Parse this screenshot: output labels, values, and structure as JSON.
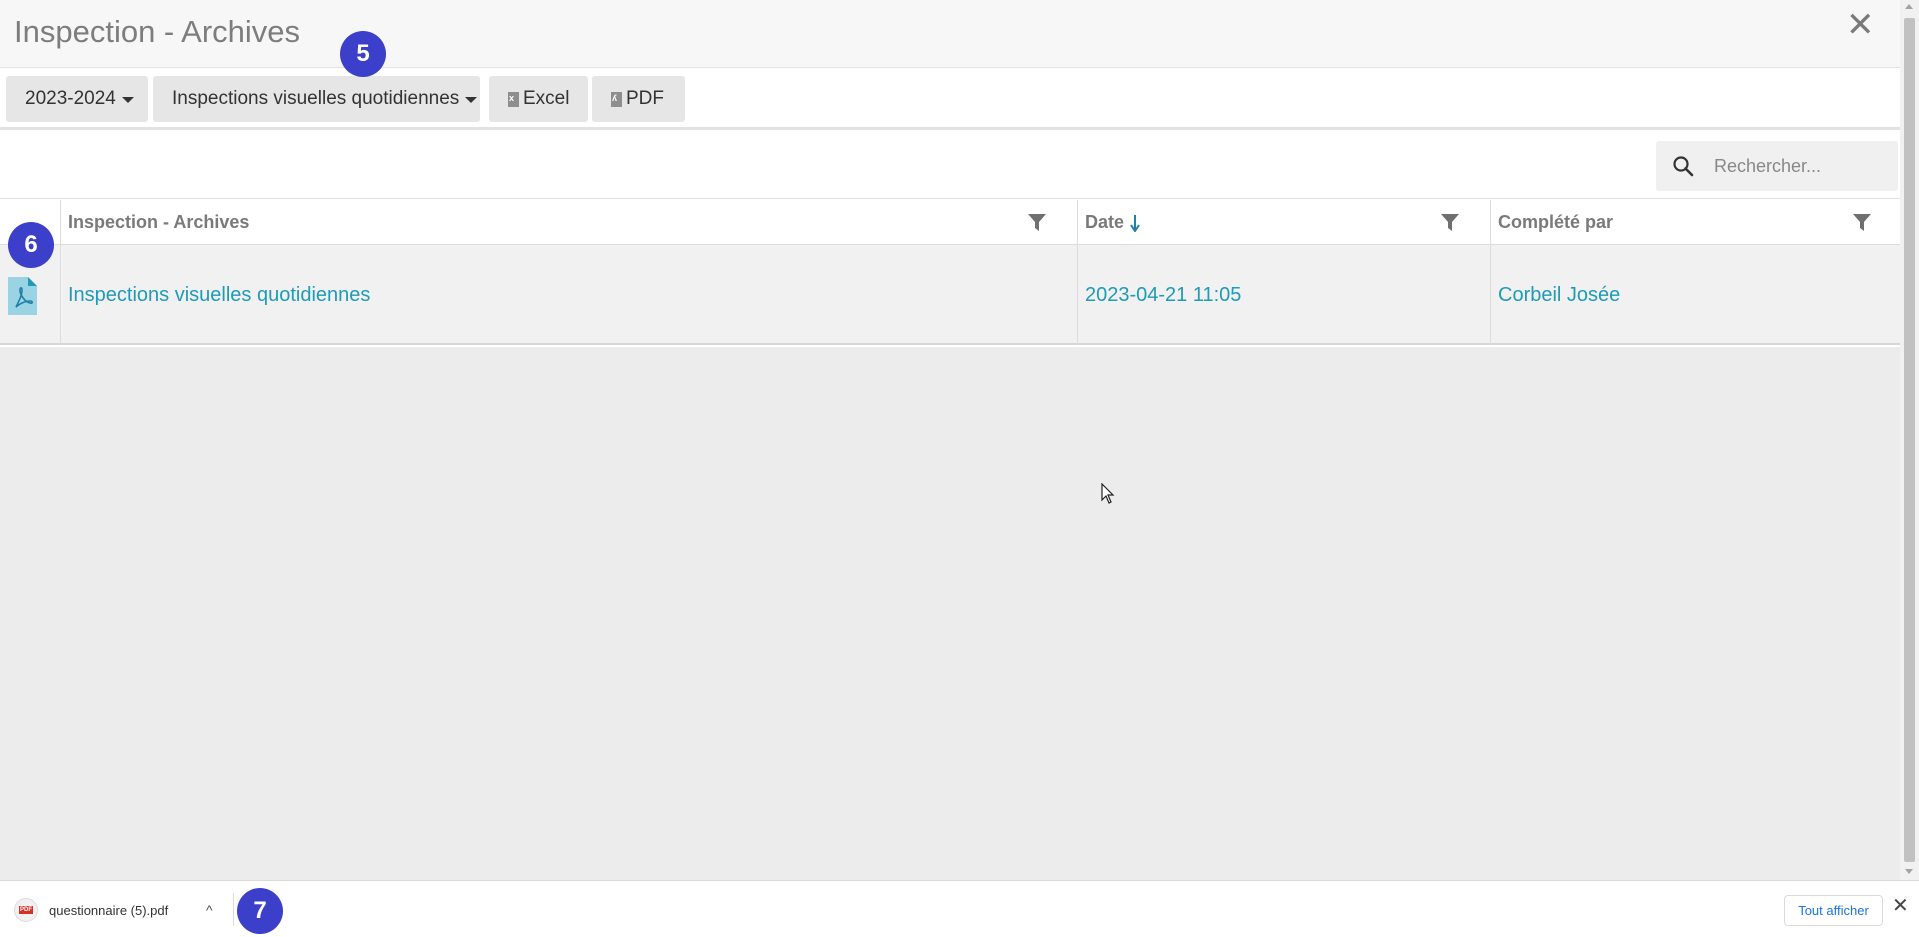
{
  "window": {
    "title": "Inspection - Archives",
    "close_symbol": "✕"
  },
  "toolbar": {
    "year_label": "2023-2024",
    "type_label": "Inspections visuelles quotidiennes",
    "excel_label": "Excel",
    "pdf_label": "PDF"
  },
  "search": {
    "placeholder": "Rechercher..."
  },
  "table": {
    "columns": [
      {
        "label": "Inspection - Archives"
      },
      {
        "label": "Date"
      },
      {
        "label": "Complété par"
      }
    ],
    "rows": [
      {
        "inspection": "Inspections visuelles quotidiennes",
        "date": "2023-04-21 11:05",
        "completed_by": "Corbeil Josée"
      }
    ]
  },
  "download_bar": {
    "file_icon_text": "PDF",
    "file_name": "questionnaire (5).pdf",
    "chevron": "^",
    "show_all_label": "Tout afficher",
    "close_symbol": "✕"
  },
  "badges": [
    "5",
    "6",
    "7"
  ],
  "colors": {
    "link": "#1f9bb5",
    "badge": "#3b3fc9",
    "button_bg": "#e6e6e6",
    "content_bg": "#ececec"
  },
  "icons": {
    "search": "search-icon",
    "filter": "filter-icon",
    "sort": "sort-down-arrow-icon",
    "pdf_doc": "pdf-document-icon",
    "excel_file": "excel-file-icon",
    "pdf_file": "pdf-file-icon"
  }
}
